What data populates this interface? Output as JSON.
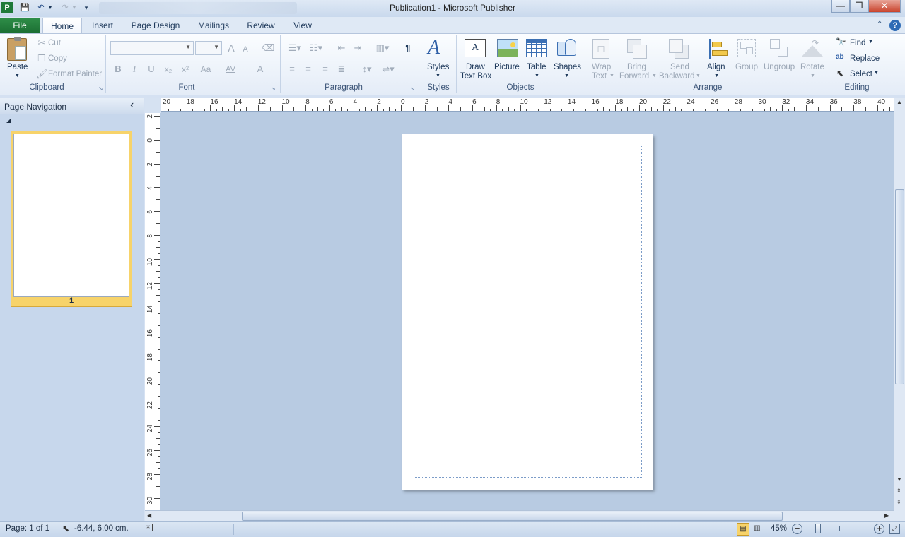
{
  "window": {
    "title": "Publication1  -  Microsoft Publisher",
    "app_icon_letter": "P",
    "minimize_glyph": "—",
    "restore_glyph": "❐",
    "close_glyph": "✕"
  },
  "tabs": [
    {
      "label": "File"
    },
    {
      "label": "Home"
    },
    {
      "label": "Insert"
    },
    {
      "label": "Page Design"
    },
    {
      "label": "Mailings"
    },
    {
      "label": "Review"
    },
    {
      "label": "View"
    }
  ],
  "clipboard": {
    "paste": "Paste",
    "cut": "Cut",
    "copy": "Copy",
    "format_painter": "Format Painter",
    "group_label": "Clipboard"
  },
  "font": {
    "font_name_value": "",
    "font_size_value": "",
    "group_label": "Font",
    "bold": "B",
    "italic": "I",
    "underline": "U",
    "subscript": "x₂",
    "superscript": "x²",
    "change_case": "Aa",
    "grow": "A",
    "shrink": "A",
    "char_spacing": "AV",
    "font_color": "A"
  },
  "paragraph": {
    "group_label": "Paragraph",
    "pilcrow": "¶"
  },
  "styles": {
    "label": "Styles",
    "group_label": "Styles"
  },
  "objects": {
    "draw_text_box_line1": "Draw",
    "draw_text_box_line2": "Text Box",
    "picture": "Picture",
    "table": "Table",
    "shapes": "Shapes",
    "group_label": "Objects"
  },
  "arrange": {
    "wrap_text_line1": "Wrap",
    "wrap_text_line2": "Text",
    "bring_forward_line1": "Bring",
    "bring_forward_line2": "Forward",
    "send_backward_line1": "Send",
    "send_backward_line2": "Backward",
    "align": "Align",
    "group": "Group",
    "ungroup": "Ungroup",
    "rotate": "Rotate",
    "group_label": "Arrange"
  },
  "editing": {
    "find": "Find",
    "replace": "Replace",
    "select": "Select",
    "group_label": "Editing"
  },
  "nav_pane": {
    "title": "Page Navigation",
    "collapse_glyph": "‹",
    "pages": [
      {
        "number": "1"
      }
    ]
  },
  "h_ruler_ticks": [
    "20",
    "18",
    "16",
    "14",
    "12",
    "10",
    "8",
    "6",
    "4",
    "2",
    "0",
    "2",
    "4",
    "6",
    "8",
    "10",
    "12",
    "14",
    "16",
    "18",
    "20",
    "22",
    "24",
    "26",
    "28",
    "30",
    "32",
    "34",
    "36",
    "38",
    "40"
  ],
  "v_ruler_ticks": [
    "2",
    "0",
    "2",
    "4",
    "6",
    "8",
    "10",
    "12",
    "14",
    "16",
    "18",
    "20",
    "22",
    "24",
    "26",
    "28",
    "30"
  ],
  "status": {
    "page": "Page: 1 of 1",
    "position": "-6.44, 6.00 cm.",
    "zoom": "45%"
  },
  "colors": {
    "file_tab": "#1f7a3a",
    "workspace": "#b8cbe2",
    "nav_selected": "#f7d36a"
  }
}
